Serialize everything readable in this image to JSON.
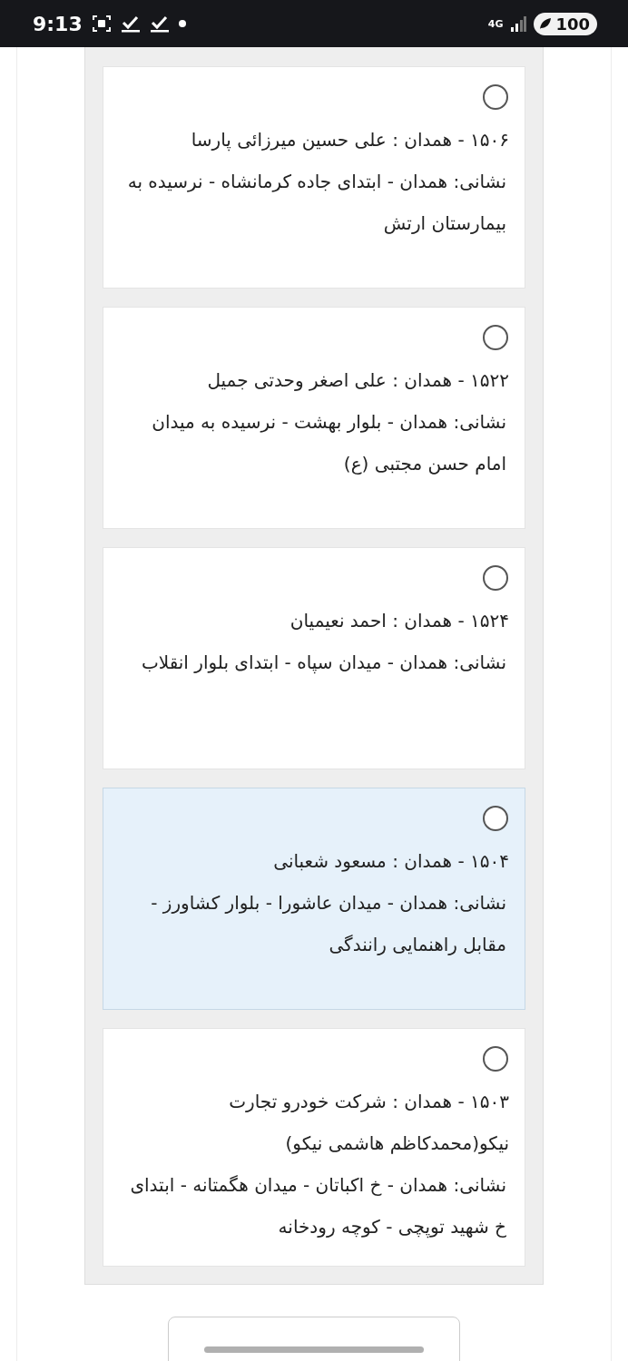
{
  "status_bar": {
    "time": "9:13",
    "network": "4G",
    "battery": "100"
  },
  "options": [
    {
      "title": "۱۵۰۶ - همدان : علی حسین میرزائی پارسا",
      "address": "نشانی: همدان - ابتدای جاده کرمانشاه - نرسیده به بیمارستان ارتش",
      "selected": false,
      "highlighted": false
    },
    {
      "title": "۱۵۲۲ - همدان : علی اصغر وحدتی جمیل",
      "address": "نشانی: همدان - بلوار بهشت - نرسیده به میدان امام حسن مجتبی (ع)",
      "selected": false,
      "highlighted": false
    },
    {
      "title": "۱۵۲۴ - همدان : احمد نعیمیان",
      "address": "نشانی: همدان - میدان سپاه - ابتدای بلوار انقلاب",
      "selected": false,
      "highlighted": false
    },
    {
      "title": "۱۵۰۴ - همدان : مسعود شعبانی",
      "address": "نشانی: همدان - میدان عاشورا - بلوار کشاورز - مقابل راهنمایی رانندگی",
      "selected": false,
      "highlighted": true
    },
    {
      "title": "۱۵۰۳ - همدان : شرکت خودرو تجارت نیکو(محمدکاظم هاشمی نیکو)",
      "address": "نشانی: همدان - خ اکباتان - میدان هگمتانه - ابتدای خ شهید توپچی - کوچه رودخانه",
      "selected": false,
      "highlighted": false
    }
  ]
}
